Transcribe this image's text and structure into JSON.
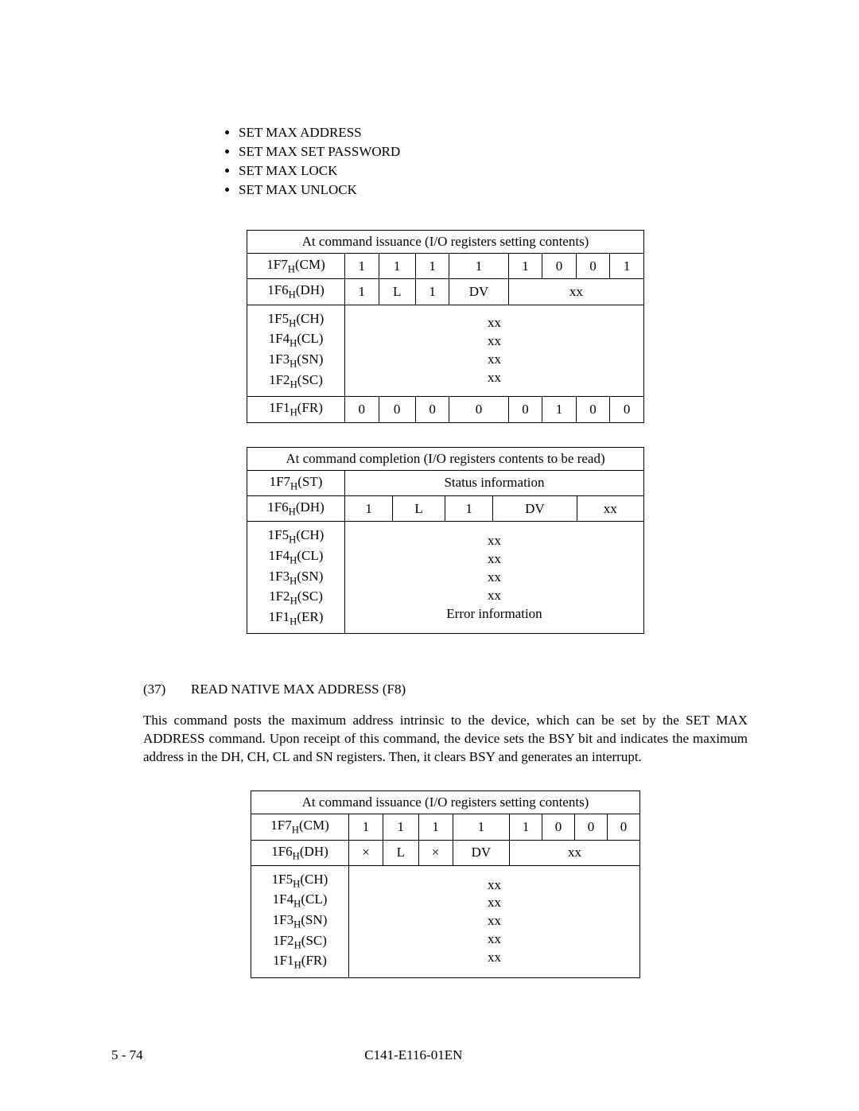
{
  "bullets": [
    "SET MAX ADDRESS",
    "SET MAX SET PASSWORD",
    "SET MAX LOCK",
    "SET MAX UNLOCK"
  ],
  "t1": {
    "caption": "At command issuance (I/O registers setting contents)",
    "r1_label": "1F7",
    "r1_suf": "(CM)",
    "r1_bits": [
      "1",
      "1",
      "1",
      "1",
      "1",
      "0",
      "0",
      "1"
    ],
    "r2_label": "1F6",
    "r2_suf": "(DH)",
    "r2_c1": "1",
    "r2_c2": "L",
    "r2_c3": "1",
    "r2_c4": "DV",
    "r2_c5": "xx",
    "stack_labels": [
      "1F5",
      "1F4",
      "1F3",
      "1F2"
    ],
    "stack_suf": [
      "(CH)",
      "(CL)",
      "(SN)",
      "(SC)"
    ],
    "stack_val": [
      "xx",
      "xx",
      "xx",
      "xx"
    ],
    "r4_label": "1F1",
    "r4_suf": "(FR)",
    "r4_bits": [
      "0",
      "0",
      "0",
      "0",
      "0",
      "1",
      "0",
      "0"
    ]
  },
  "t2": {
    "caption": "At command completion (I/O registers contents to be read)",
    "r1_label": "1F7",
    "r1_suf": "(ST)",
    "r1_val": "Status information",
    "r2_label": "1F6",
    "r2_suf": "(DH)",
    "r2_c1": "1",
    "r2_c2": "L",
    "r2_c3": "1",
    "r2_c4": "DV",
    "r2_c5": "xx",
    "stack_labels": [
      "1F5",
      "1F4",
      "1F3",
      "1F2",
      "1F1"
    ],
    "stack_suf": [
      "(CH)",
      "(CL)",
      "(SN)",
      "(SC)",
      "(ER)"
    ],
    "stack_val": [
      "xx",
      "xx",
      "xx",
      "xx",
      "Error information"
    ]
  },
  "section_num": "(37)",
  "section_title": "READ NATIVE MAX ADDRESS (F8)",
  "para": "This command posts the maximum address intrinsic to the device, which can be set by the SET MAX ADDRESS command. Upon receipt of this command, the device sets the BSY bit and indicates the maximum address in the DH, CH, CL and SN registers. Then, it clears BSY and generates an interrupt.",
  "t3": {
    "caption": "At command issuance (I/O registers setting contents)",
    "r1_label": "1F7",
    "r1_suf": "(CM)",
    "r1_bits": [
      "1",
      "1",
      "1",
      "1",
      "1",
      "0",
      "0",
      "0"
    ],
    "r2_label": "1F6",
    "r2_suf": "(DH)",
    "r2_c1": "×",
    "r2_c2": "L",
    "r2_c3": "×",
    "r2_c4": "DV",
    "r2_c5": "xx",
    "stack_labels": [
      "1F5",
      "1F4",
      "1F3",
      "1F2",
      "1F1"
    ],
    "stack_suf": [
      "(CH)",
      "(CL)",
      "(SN)",
      "(SC)",
      "(FR)"
    ],
    "stack_val": [
      "xx",
      "xx",
      "xx",
      "xx",
      "xx"
    ]
  },
  "footer_left": "5 - 74",
  "footer_center": "C141-E116-01EN"
}
